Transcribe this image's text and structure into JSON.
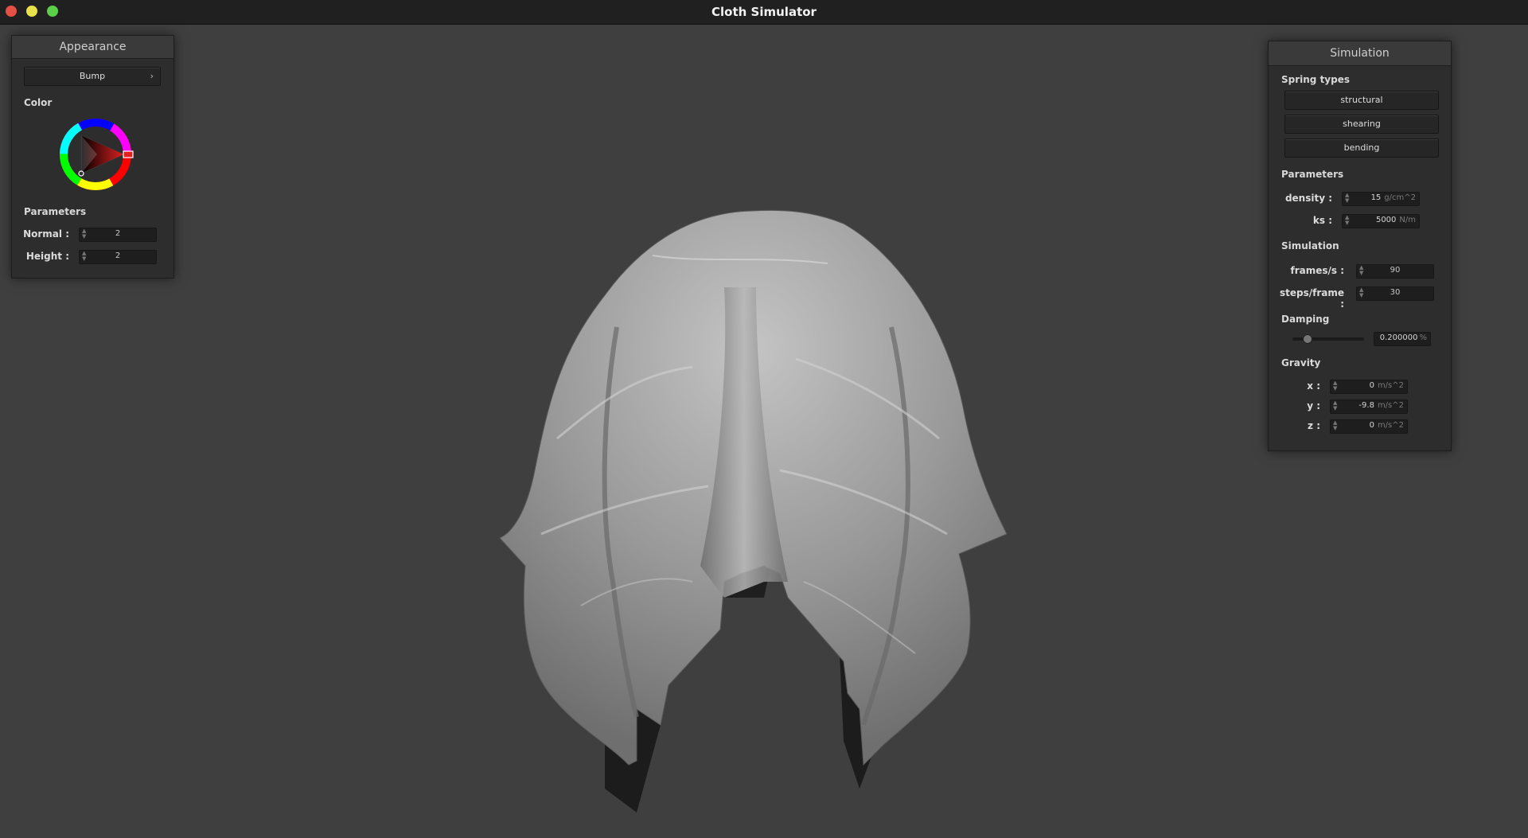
{
  "window": {
    "title": "Cloth Simulator"
  },
  "appearance": {
    "title": "Appearance",
    "shader_dropdown": "Bump",
    "color_label": "Color",
    "parameters_label": "Parameters",
    "normal": {
      "label": "Normal :",
      "value": "2"
    },
    "height": {
      "label": "Height :",
      "value": "2"
    }
  },
  "simulation": {
    "title": "Simulation",
    "spring_types_label": "Spring types",
    "springs": [
      "structural",
      "shearing",
      "bending"
    ],
    "parameters_label": "Parameters",
    "density": {
      "label": "density :",
      "value": "15",
      "unit": "g/cm^2"
    },
    "ks": {
      "label": "ks :",
      "value": "5000",
      "unit": "N/m"
    },
    "simulation_label": "Simulation",
    "frames": {
      "label": "frames/s :",
      "value": "90"
    },
    "steps": {
      "label": "steps/frame :",
      "value": "30"
    },
    "damping_label": "Damping",
    "damping": {
      "value": "0.200000",
      "unit": "%",
      "level": 0.2
    },
    "gravity_label": "Gravity",
    "gx": {
      "label": "x :",
      "value": "0",
      "unit": "m/s^2"
    },
    "gy": {
      "label": "y :",
      "value": "-9.8",
      "unit": "m/s^2"
    },
    "gz": {
      "label": "z :",
      "value": "0",
      "unit": "m/s^2"
    }
  },
  "colors": {
    "titlebar": "#202020",
    "viewport": "#3f3f3f",
    "panel": "#2d2d2d",
    "cloth": "#9a9a9a",
    "wheel_selected": "#e02020"
  }
}
